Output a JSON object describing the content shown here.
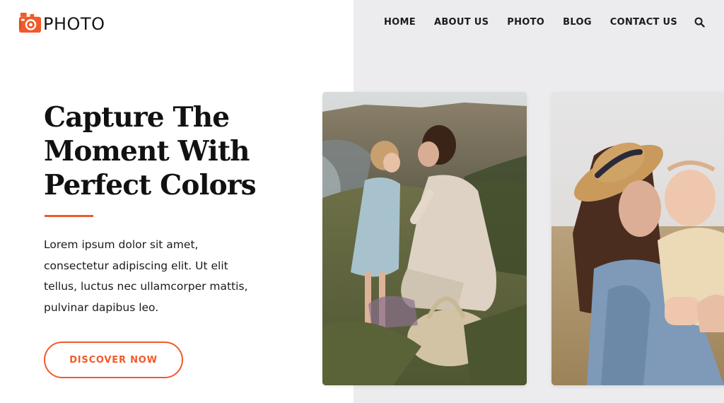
{
  "header": {
    "logo_text": "PHOTO",
    "logo_icon": "camera-icon",
    "nav": [
      "HOME",
      "ABOUT US",
      "PHOTO",
      "BLOG",
      "CONTACT US"
    ],
    "search_icon": "search-icon"
  },
  "hero": {
    "title": "Capture The Moment With Perfect Colors",
    "body": "Lorem ipsum dolor sit amet, consectetur adipiscing elit. Ut elit tellus, luctus nec ullamcorper mattis, pulvinar dapibus leo.",
    "cta_label": "DISCOVER NOW"
  },
  "colors": {
    "accent": "#f15a29",
    "panel": "#ececee",
    "text": "#111111"
  }
}
